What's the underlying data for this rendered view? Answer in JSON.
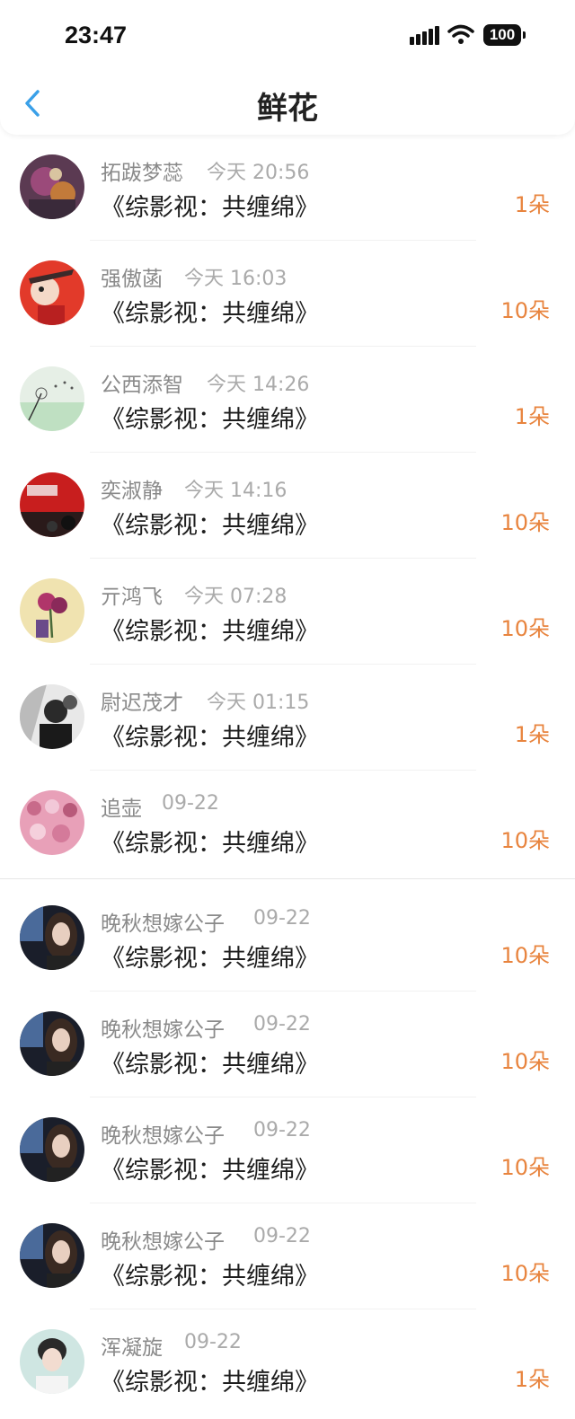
{
  "status_bar": {
    "time": "23:47",
    "battery": "100"
  },
  "header": {
    "title": "鲜花",
    "back_icon": "chevron-left-icon"
  },
  "colors": {
    "accent": "#3aa0e8",
    "count": "#e8843e"
  },
  "records": [
    {
      "user": "拓跋梦蕊",
      "time": "今天 20:56",
      "book": "《综影视：共缠绵》",
      "count": "1朵"
    },
    {
      "user": "强傲菡",
      "time": "今天 16:03",
      "book": "《综影视：共缠绵》",
      "count": "10朵"
    },
    {
      "user": "公西添智",
      "time": "今天 14:26",
      "book": "《综影视：共缠绵》",
      "count": "1朵"
    },
    {
      "user": "奕淑静",
      "time": "今天 14:16",
      "book": "《综影视：共缠绵》",
      "count": "10朵"
    },
    {
      "user": "亓鸿飞",
      "time": "今天 07:28",
      "book": "《综影视：共缠绵》",
      "count": "10朵"
    },
    {
      "user": "尉迟茂才",
      "time": "今天 01:15",
      "book": "《综影视：共缠绵》",
      "count": "1朵"
    },
    {
      "user": "追壶",
      "time": "09-22",
      "book": "《综影视：共缠绵》",
      "count": "10朵"
    },
    {
      "user": "晚秋想嫁公子",
      "time": "09-22",
      "book": "《综影视：共缠绵》",
      "count": "10朵"
    },
    {
      "user": "晚秋想嫁公子",
      "time": "09-22",
      "book": "《综影视：共缠绵》",
      "count": "10朵"
    },
    {
      "user": "晚秋想嫁公子",
      "time": "09-22",
      "book": "《综影视：共缠绵》",
      "count": "10朵"
    },
    {
      "user": "晚秋想嫁公子",
      "time": "09-22",
      "book": "《综影视：共缠绵》",
      "count": "10朵"
    },
    {
      "user": "浑凝旋",
      "time": "09-22",
      "book": "《综影视：共缠绵》",
      "count": "1朵"
    }
  ]
}
